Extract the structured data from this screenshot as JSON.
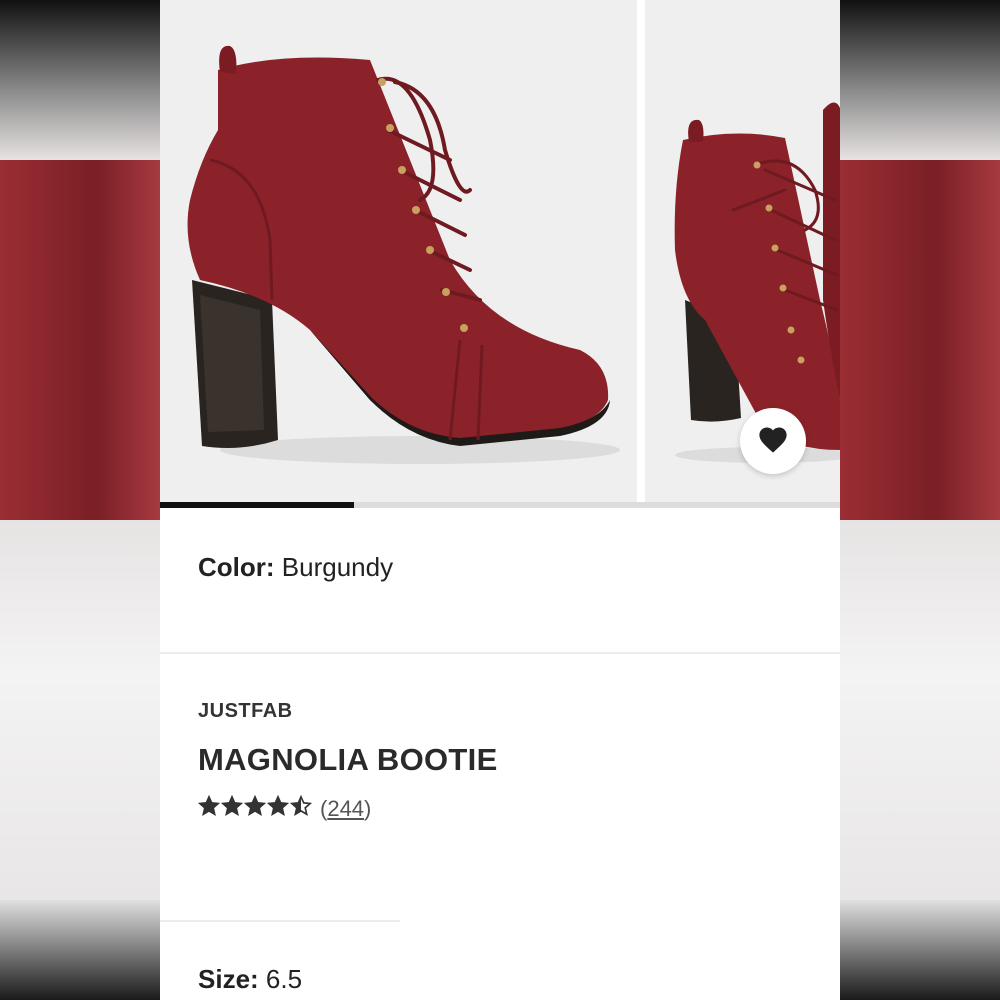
{
  "product": {
    "color_label": "Color:",
    "color_value": "Burgundy",
    "brand": "JUSTFAB",
    "name": "MAGNOLIA BOOTIE",
    "rating_stars": 4.5,
    "review_count_open": "(",
    "review_count": "244",
    "review_count_close": ")",
    "size_label": "Size:",
    "size_value": "6.5"
  },
  "carousel": {
    "progress_fraction": 0.285
  },
  "icons": {
    "favorite": "heart-icon",
    "star": "star-icon"
  },
  "colors": {
    "boot": "#8c2229",
    "heel": "#2a2420",
    "progress": "#111111"
  }
}
